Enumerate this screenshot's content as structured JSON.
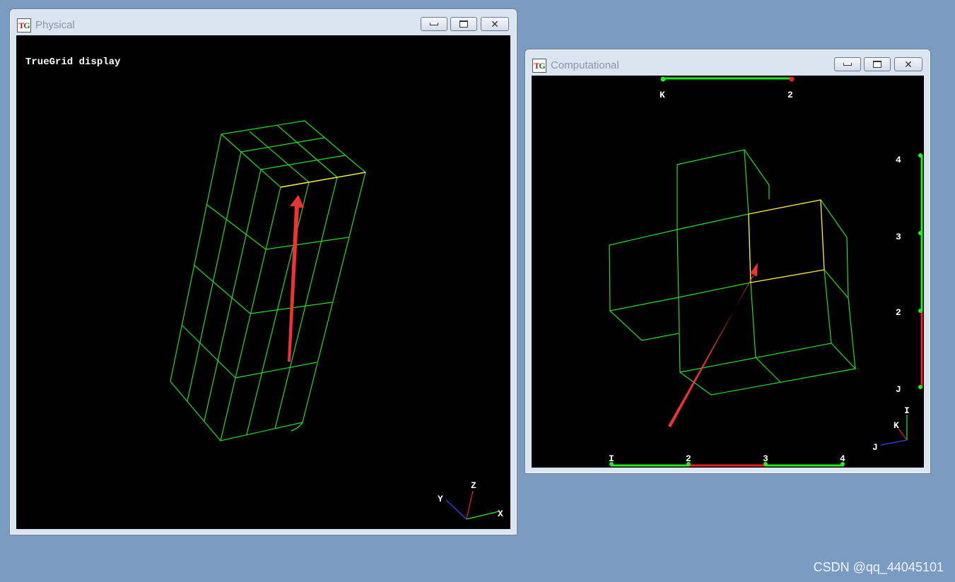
{
  "physical_window": {
    "title": "Physical",
    "logo_text": "TG",
    "display_label": "TrueGrid display",
    "axes": {
      "x": "X",
      "y": "Y",
      "z": "Z"
    }
  },
  "computational_window": {
    "title": "Computational",
    "logo_text": "TG",
    "k_bar": {
      "start": "K",
      "end": "2"
    },
    "j_bar": {
      "start": "J",
      "ticks": [
        "2",
        "3",
        "4"
      ]
    },
    "i_bar": {
      "start": "I",
      "ticks": [
        "2",
        "3",
        "4"
      ]
    },
    "axes": {
      "i": "I",
      "j": "J",
      "k": "K"
    }
  },
  "colors": {
    "mesh": "#22dd22",
    "highlight": "#ffee33",
    "arrow": "#ee3333",
    "bar_active": "#22ee22",
    "bar_selected": "#ee2222"
  },
  "watermark": "CSDN @qq_44045101"
}
